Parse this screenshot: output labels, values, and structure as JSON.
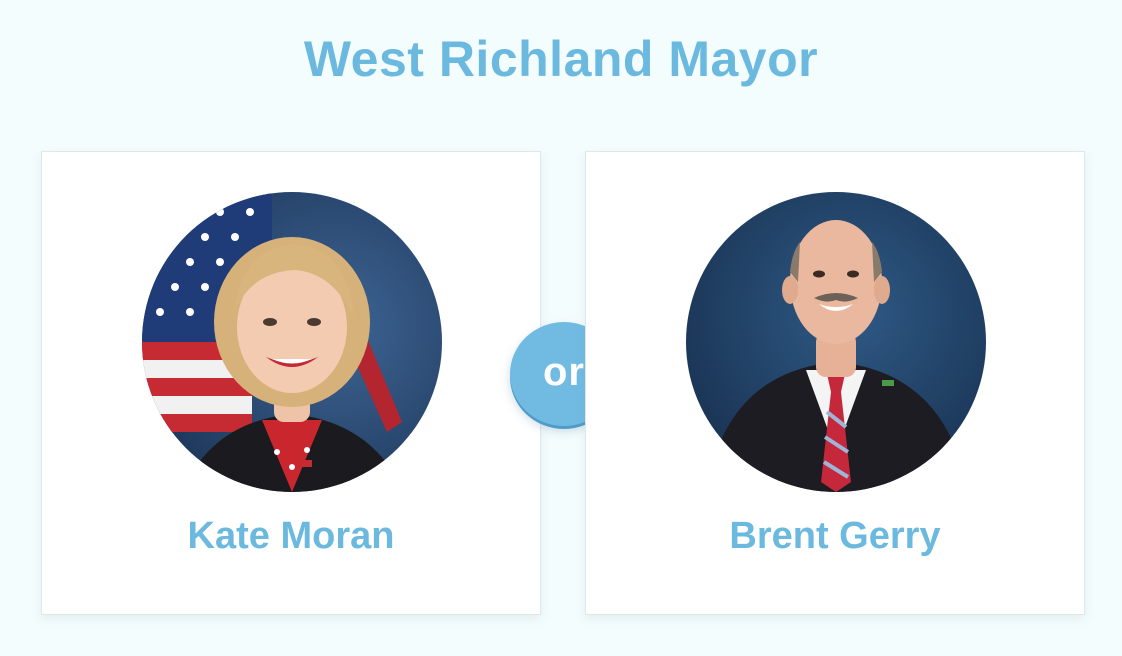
{
  "page": {
    "title": "West Richland Mayor",
    "separator": "or"
  },
  "candidates": [
    {
      "name": "Kate Moran"
    },
    {
      "name": "Brent Gerry"
    }
  ],
  "colors": {
    "background": "#f4fdfe",
    "accent": "#6cb9df",
    "card": "#ffffff",
    "badge": "#71bbe3"
  }
}
